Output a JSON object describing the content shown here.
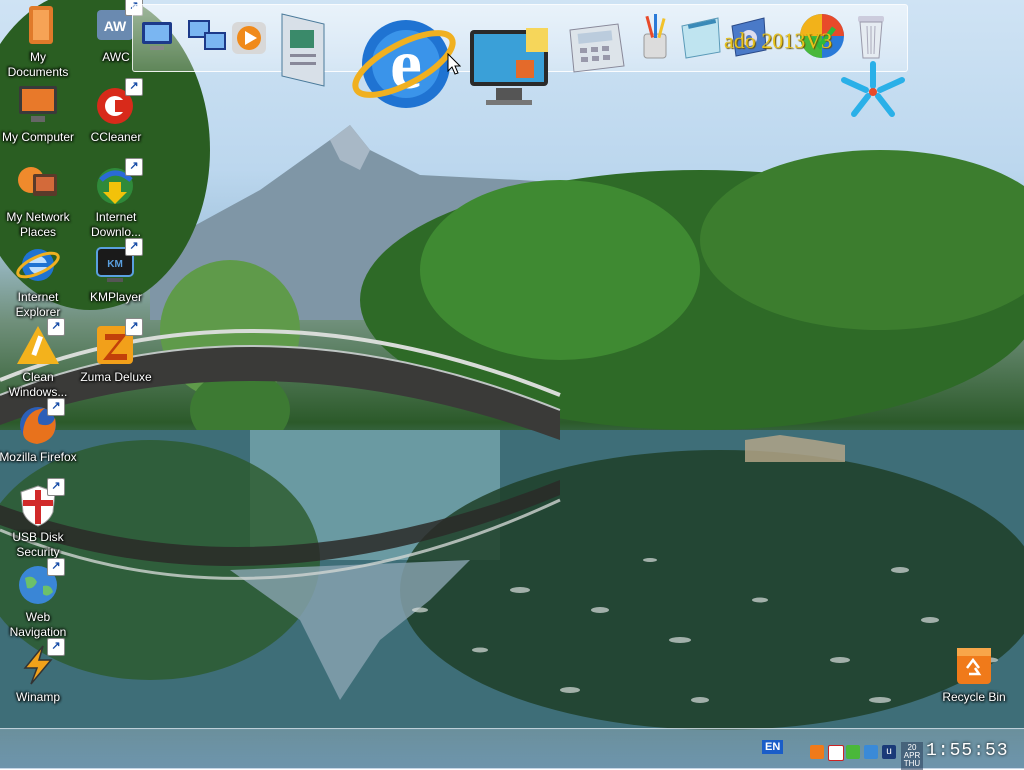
{
  "desktop": {
    "icons": [
      {
        "label": "My Documents",
        "icon": "folder-icon"
      },
      {
        "label": "AWC",
        "icon": "awc-icon"
      },
      {
        "label": "My Computer",
        "icon": "computer-icon"
      },
      {
        "label": "CCleaner",
        "icon": "ccleaner-icon"
      },
      {
        "label": "My Network Places",
        "icon": "network-icon"
      },
      {
        "label": "Internet Downlo...",
        "icon": "download-manager-icon"
      },
      {
        "label": "Internet Explorer",
        "icon": "internet-explorer-icon"
      },
      {
        "label": "KMPlayer",
        "icon": "kmplayer-icon"
      },
      {
        "label": "Clean Windows...",
        "icon": "cleaner-icon"
      },
      {
        "label": "Zuma Deluxe",
        "icon": "zuma-icon"
      },
      {
        "label": "Mozilla Firefox",
        "icon": "firefox-icon"
      },
      {
        "label": "USB Disk Security",
        "icon": "shield-icon"
      },
      {
        "label": "Web Navigation",
        "icon": "globe-icon"
      },
      {
        "label": "Winamp",
        "icon": "winamp-icon"
      },
      {
        "label": "Recycle Bin",
        "icon": "recycle-bin-icon"
      }
    ]
  },
  "dock": {
    "watermark": "ado  2013V3",
    "items": [
      "computer-icon",
      "network-icon",
      "media-player-icon",
      "document-icon",
      "internet-explorer-icon",
      "monitor-icon",
      "calculator-icon",
      "pencil-cup-icon",
      "notepad-icon",
      "settings-icon",
      "windows-logo-icon",
      "trash-icon"
    ]
  },
  "taskbar": {
    "language": "EN",
    "date_top": "20",
    "date_mid": "APR",
    "date_bottom": "THU",
    "time": "1:55:53"
  },
  "colors": {
    "watermark": "#e8c21a",
    "label_text": "#ffffff"
  }
}
